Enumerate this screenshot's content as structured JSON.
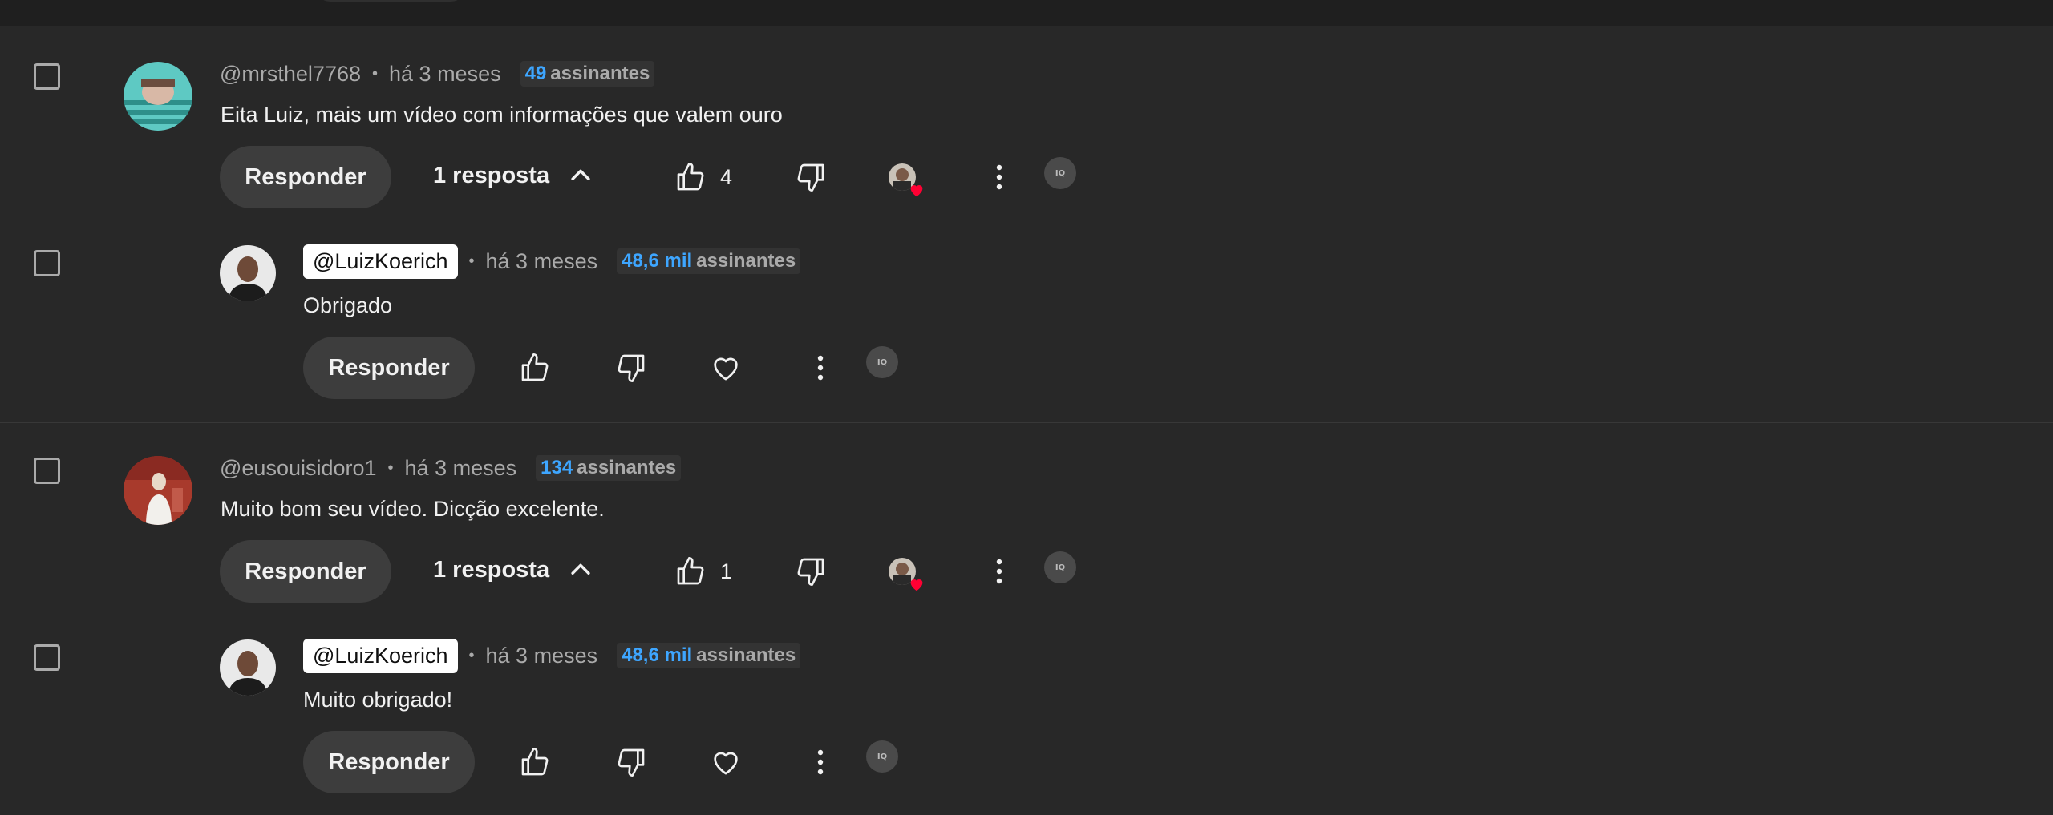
{
  "comments": [
    {
      "handle": "@mrsthel7768",
      "time": "há 3 meses",
      "subs_count": "49",
      "subs_label": "assinantes",
      "text": "Eita Luiz, mais um vídeo com informações que valem ouro",
      "reply_label": "Responder",
      "replies_label": "1 resposta",
      "likes": "4",
      "ext_label": "IQ",
      "reply": {
        "handle": "@LuizKoerich",
        "time": "há 3 meses",
        "subs_count": "48,6 mil",
        "subs_label": "assinantes",
        "text": "Obrigado",
        "reply_label": "Responder",
        "ext_label": "IQ"
      }
    },
    {
      "handle": "@eusouisidoro1",
      "time": "há 3 meses",
      "subs_count": "134",
      "subs_label": "assinantes",
      "text": "Muito bom seu vídeo. Dicção excelente.",
      "reply_label": "Responder",
      "replies_label": "1 resposta",
      "likes": "1",
      "ext_label": "IQ",
      "reply": {
        "handle": "@LuizKoerich",
        "time": "há 3 meses",
        "subs_count": "48,6 mil",
        "subs_label": "assinantes",
        "text": "Muito obrigado!",
        "reply_label": "Responder",
        "ext_label": "IQ"
      }
    }
  ],
  "icons": {
    "like": "thumbs-up-icon",
    "dislike": "thumbs-down-icon",
    "heart": "heart-icon",
    "more": "more-vertical-icon",
    "chevron": "chevron-up-icon",
    "creator_heart": "creator-heart-icon"
  },
  "colors": {
    "background": "#282828",
    "subscriber_count": "#3ea6ff",
    "heart_badge": "#ff0033"
  }
}
